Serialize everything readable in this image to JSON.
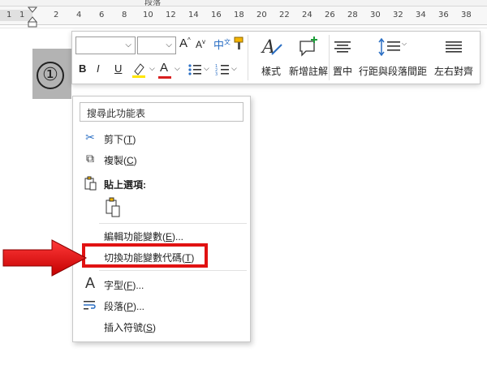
{
  "ribbon": {
    "group_label": "段落"
  },
  "ruler": {
    "numbers": [
      "1",
      "1",
      "2",
      "4",
      "6",
      "8",
      "10",
      "12",
      "14",
      "16",
      "18",
      "20",
      "22",
      "24",
      "26",
      "28",
      "30",
      "32",
      "34",
      "36",
      "38"
    ]
  },
  "document": {
    "field_char": "①"
  },
  "mini_toolbar": {
    "bold": "B",
    "italic": "I",
    "underline": "U",
    "grow_font": "A",
    "shrink_font": "A",
    "font_color_letter": "A",
    "styles_label": "樣式",
    "new_comment_label": "新增註解",
    "center_label": "置中",
    "line_spacing_label": "行距與段落間距",
    "justify_label": "左右對齊",
    "phonetic": "中"
  },
  "context_menu": {
    "search_placeholder": "搜尋此功能表",
    "items": [
      {
        "label": "剪下(",
        "key": "T",
        "suffix": ")"
      },
      {
        "label": "複製(",
        "key": "C",
        "suffix": ")"
      },
      {
        "label": "貼上選項:"
      },
      {
        "label": "編輯功能變數(",
        "key": "E",
        "suffix": ")..."
      },
      {
        "label": "切換功能變數代碼(",
        "key": "T",
        "suffix": ")"
      },
      {
        "label": "字型(",
        "key": "F",
        "suffix": ")..."
      },
      {
        "label": "段落(",
        "key": "P",
        "suffix": ")..."
      },
      {
        "label": "插入符號(",
        "key": "S",
        "suffix": ")"
      }
    ]
  },
  "colors": {
    "highlight_box": "#e11212",
    "arrow": "#e11212",
    "font_color": "#d81e1e",
    "highlighter": "#ffe600"
  }
}
